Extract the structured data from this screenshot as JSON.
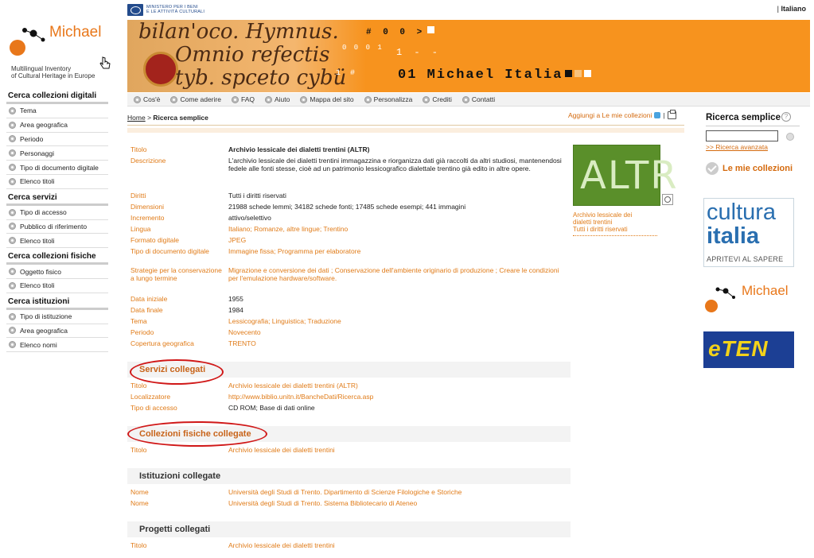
{
  "top": {
    "ministry_line1": "MINISTERO PER I BENI",
    "ministry_line2": "E LE ATTIVITÀ CULTURALI",
    "lang_sep": "|",
    "language": "Italiano"
  },
  "logo": {
    "name": "Michael",
    "subtitle_line1": "Multilingual Inventory",
    "subtitle_line2": "of Cultural Heritage in Europe"
  },
  "banner": {
    "script_line1": "bilan'oco. Hymnus.",
    "script_line2": "Omnio refectis",
    "script_line3": "tyb. spceto cybü",
    "code_line1": "# 0 0 >",
    "code_line2": "0 0 0 1",
    "code_line3": "1 - -",
    "code_line4": "1 #",
    "title": "01 Michael Italia"
  },
  "nav": {
    "items": [
      "Cos'è",
      "Come aderire",
      "FAQ",
      "Aiuto",
      "Mappa del sito",
      "Personalizza",
      "Crediti",
      "Contatti"
    ]
  },
  "sidebar": {
    "sections": [
      {
        "title": "Cerca collezioni digitali",
        "items": [
          "Tema",
          "Area geografica",
          "Periodo",
          "Personaggi",
          "Tipo di documento digitale",
          "Elenco titoli"
        ]
      },
      {
        "title": "Cerca servizi",
        "items": [
          "Tipo di accesso",
          "Pubblico di riferimento",
          "Elenco titoli"
        ]
      },
      {
        "title": "Cerca collezioni fisiche",
        "items": [
          "Oggetto fisico",
          "Elenco titoli"
        ]
      },
      {
        "title": "Cerca istituzioni",
        "items": [
          "Tipo di istituzione",
          "Area geografica",
          "Elenco nomi"
        ]
      }
    ]
  },
  "breadcrumb": {
    "home": "Home",
    "sep": ">",
    "current": "Ricerca semplice"
  },
  "actions": {
    "add_to_collections": "Aggiungi a Le mie collezioni",
    "sep": "|"
  },
  "record": {
    "rows": [
      {
        "label": "Titolo",
        "value": "Archivio lessicale dei dialetti trentini (ALTR)"
      },
      {
        "label": "Descrizione",
        "value": "L'archivio lessicale dei dialetti trentini immagazzina e riorganizza dati già raccolti da altri studiosi, mantenendosi fedele alle fonti stesse, cioè ad un patrimonio lessicografico dialettale trentino già edito in altre opere."
      },
      {
        "label": "Diritti",
        "value": "Tutti i diritti riservati"
      },
      {
        "label": "Dimensioni",
        "value": "21988 schede lemmi; 34182 schede fonti; 17485 schede esempi; 441 immagini"
      },
      {
        "label": "Incremento",
        "value": "attivo/selettivo"
      },
      {
        "label": "Lingua",
        "value": "Italiano; Romanze, altre lingue; Trentino"
      },
      {
        "label": "Formato digitale",
        "value": "JPEG"
      },
      {
        "label": "Tipo di documento digitale",
        "value": "Immagine fissa; Programma per elaboratore"
      },
      {
        "label": "Strategie per la conservazione a lungo termine",
        "value": "Migrazione e conversione dei dati ; Conservazione dell'ambiente originario di produzione ; Creare le condizioni per l'emulazione hardware/software."
      },
      {
        "label": "Data iniziale",
        "value": "1955"
      },
      {
        "label": "Data finale",
        "value": "1984"
      },
      {
        "label": "Tema",
        "value": "Lessicografia; Linguistica; Traduzione"
      },
      {
        "label": "Periodo",
        "value": "Novecento"
      },
      {
        "label": "Copertura geografica",
        "value": "TRENTO"
      }
    ]
  },
  "thumbnail": {
    "image_text": "ALTR",
    "caption_line1": "Archivio lessicale dei",
    "caption_line2": "dialetti trentini",
    "caption_line3": "Tutti i diritti riservati"
  },
  "servizi": {
    "title": "Servizi collegati",
    "rows": [
      {
        "label": "Titolo",
        "value": "Archivio lessicale dei dialetti trentini (ALTR)"
      },
      {
        "label": "Localizzatore",
        "value": "http://www.biblio.unitn.it/BancheDati/Ricerca.asp"
      },
      {
        "label": "Tipo di accesso",
        "value": "CD ROM; Base di dati online"
      }
    ]
  },
  "collezioni": {
    "title": "Collezioni fisiche collegate",
    "rows": [
      {
        "label": "Titolo",
        "value": "Archivio lessicale dei dialetti trentini"
      }
    ]
  },
  "istituzioni": {
    "title": "Istituzioni collegate",
    "rows": [
      {
        "label": "Nome",
        "value": "Università degli Studi di Trento. Dipartimento di Scienze Filologiche e Storiche"
      },
      {
        "label": "Nome",
        "value": "Università degli Studi di Trento. Sistema Bibliotecario di Ateneo"
      }
    ]
  },
  "progetti": {
    "title": "Progetti collegati",
    "rows": [
      {
        "label": "Titolo",
        "value": "Archivio lessicale dei dialetti trentini"
      }
    ]
  },
  "right": {
    "search_title": "Ricerca semplice",
    "help": "?",
    "search_value": "",
    "advanced": ">> Ricerca avanzata",
    "my_collections": "Le mie collezioni",
    "cultura_1": "cultura",
    "cultura_2": "italia",
    "cultura_3": "APRITEVI AL SAPERE",
    "michael": "Michael",
    "eten": "eTEN"
  },
  "colors": {
    "accent": "#e07b18",
    "banner": "#f7931e",
    "highlight_circle": "#d01818"
  }
}
